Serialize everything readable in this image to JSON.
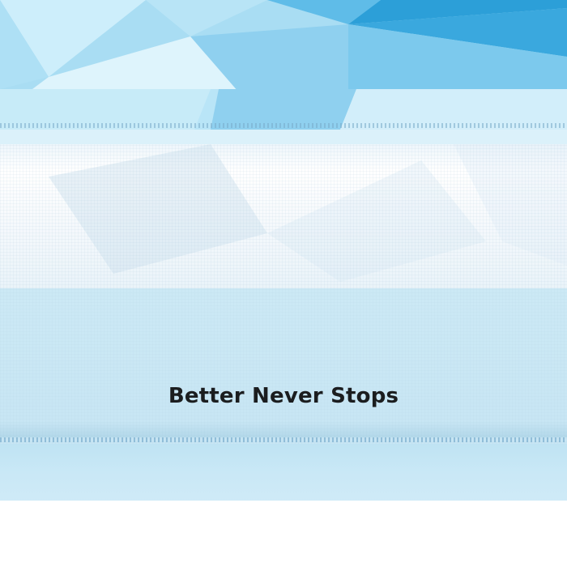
{
  "product_detail": {
    "slogan": "Better Never Stops"
  },
  "colors": {
    "fabric_light_blue": "#c8e6f4",
    "fabric_mid_blue": "#7fc8ea",
    "fabric_deep_blue": "#2c9fd8",
    "text_black": "#1b1d1f"
  }
}
